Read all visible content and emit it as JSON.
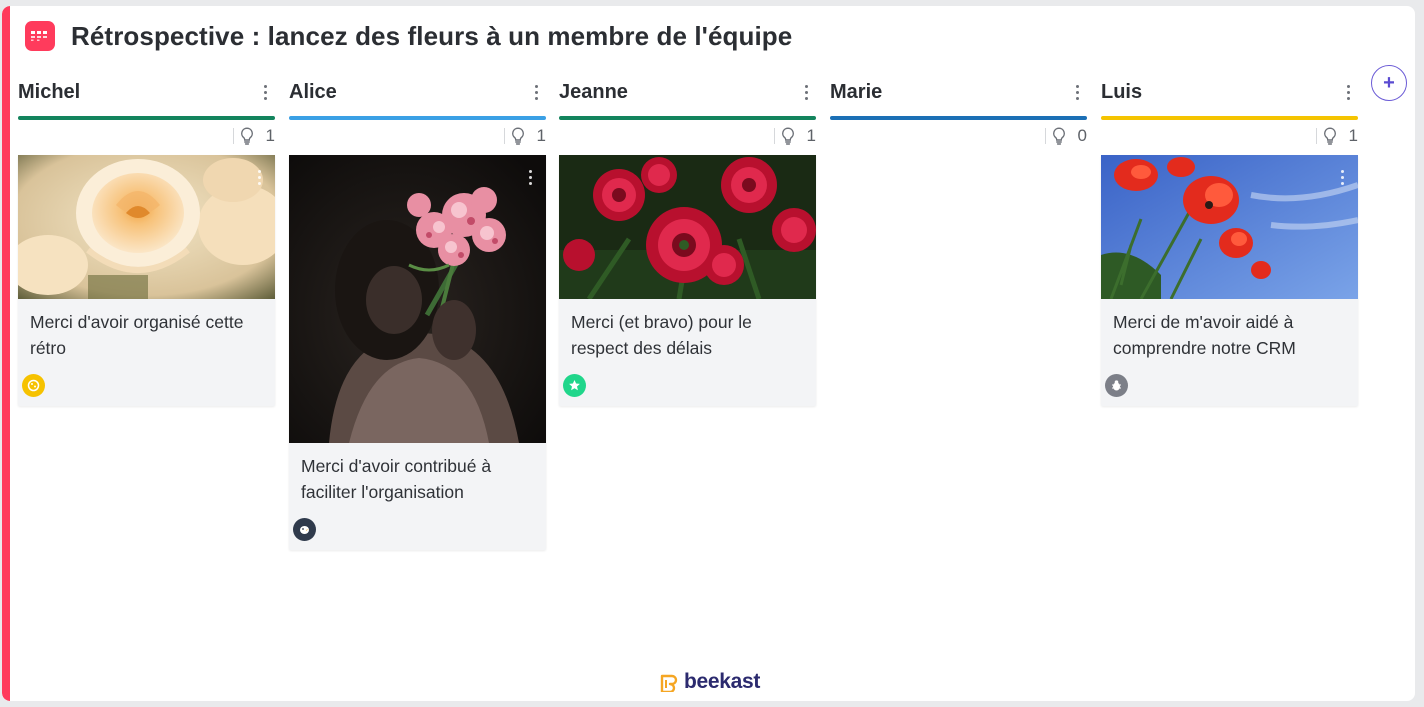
{
  "title": "Rétrospective : lancez des fleurs à un membre de l'équipe",
  "brand": "beekast",
  "columns": [
    {
      "name": "Michel",
      "count": "1",
      "color": "#13845d"
    },
    {
      "name": "Alice",
      "count": "1",
      "color": "#3aa0e5"
    },
    {
      "name": "Jeanne",
      "count": "1",
      "color": "#13845d"
    },
    {
      "name": "Marie",
      "count": "0",
      "color": "#1b6fb5"
    },
    {
      "name": "Luis",
      "count": "1",
      "color": "#f5c400"
    }
  ],
  "cards": [
    {
      "column": "Michel",
      "text": "Merci d'avoir organisé cette rétro",
      "image": "cream-rose-icon",
      "avatar_color": "#f6c200",
      "avatar": "cookie-avatar-icon"
    },
    {
      "column": "Alice",
      "text": "Merci d'avoir contribué à faciliter l'organisation",
      "image": "woman-with-pink-flowers-icon",
      "avatar_color": "#2f3a4c",
      "avatar": "bird-avatar-icon"
    },
    {
      "column": "Jeanne",
      "text": "Merci (et bravo) pour le respect des délais",
      "image": "red-ranunculus-icon",
      "avatar_color": "#20d68b",
      "avatar": "star-avatar-icon"
    },
    {
      "column": "Luis",
      "text": "Merci de m'avoir aidé à comprendre notre CRM",
      "image": "red-poppies-sky-icon",
      "avatar_color": "#7c7f88",
      "avatar": "bug-avatar-icon"
    }
  ],
  "colors": {
    "accent": "#ff3b5c",
    "add_button": "#5a4bd1",
    "brand_text": "#2b2a6e",
    "brand_icon": "#f5a623"
  }
}
